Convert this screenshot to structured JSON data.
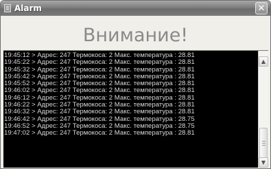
{
  "window": {
    "title": "Alarm",
    "close_glyph": "✕"
  },
  "header": {
    "text": "Внимание!"
  },
  "log": {
    "lines": [
      "19:45:12 > Адрес: 247 Термокоса: 2 Макс. температура : 28.81",
      "19:45:22 > Адрес: 247 Термокоса: 2 Макс. температура : 28.81",
      "19:45:32 > Адрес: 247 Термокоса: 2 Макс. температура : 28.81",
      "19:45:42 > Адрес: 247 Термокоса: 2 Макс. температура : 28.81",
      "19:45:52 > Адрес: 247 Термокоса: 2 Макс. температура : 28.81",
      "19:46:02 > Адрес: 247 Термокоса: 2 Макс. температура : 28.81",
      "19:46:12 > Адрес: 247 Термокоса: 2 Макс. температура : 28.81",
      "19:46:22 > Адрес: 247 Термокоса: 2 Макс. температура : 28.81",
      "19:46:32 > Адрес: 247 Термокоса: 2 Макс. температура : 28.81",
      "19:46:42 > Адрес: 247 Термокоса: 2 Макс. температура : 28.75",
      "19:46:52 > Адрес: 247 Термокоса: 2 Макс. температура : 28.75",
      "19:47:02 > Адрес: 247 Термокоса: 2 Макс. температура : 28.81"
    ]
  },
  "scrollbar": {
    "up_glyph": "▲",
    "down_glyph": "▼"
  },
  "colors": {
    "log_background": "#000000",
    "log_text": "#d8d8d8",
    "header_text": "#8a8a8a"
  }
}
